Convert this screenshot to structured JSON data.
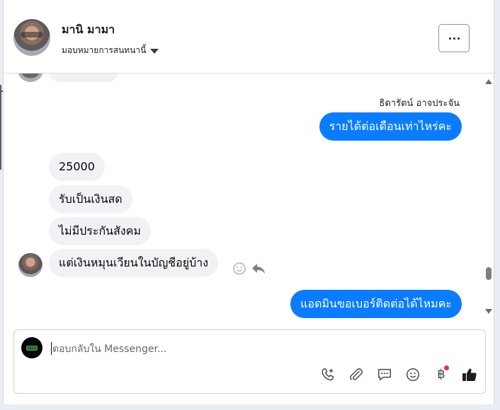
{
  "contact": {
    "name": "มานิ มามา",
    "status": "มอบหมายการสนทนานี้"
  },
  "messages": [
    {
      "direction": "out",
      "sender": "ธิดารัตน์ อาจประจัน",
      "text": "รายได้ต่อเดือนเท่าไหร่คะ"
    },
    {
      "direction": "in",
      "text": "25000"
    },
    {
      "direction": "in",
      "text": "รับเป็นเงินสด"
    },
    {
      "direction": "in",
      "text": "ไม่มีประกันสังคม"
    },
    {
      "direction": "in",
      "text": "แต่เงินหมุนเวียนในบัญชีอยู่บ้าง"
    },
    {
      "direction": "out",
      "text": "แอดมินขอเบอร์ติดต่อได้ไหมคะ"
    }
  ],
  "composer": {
    "placeholder": "ตอบกลับใน Messenger...",
    "value": ""
  },
  "toolbar": {
    "icons": [
      "phone-plus-icon",
      "paperclip-icon",
      "chat-bubble-icon",
      "emoji-icon",
      "baht-icon",
      "thumbs-up-icon"
    ],
    "baht_symbol": "฿"
  },
  "colors": {
    "outgoing_bubble": "#0a7cff",
    "incoming_bubble": "#f0f2f5",
    "notification_dot": "#f02849"
  }
}
